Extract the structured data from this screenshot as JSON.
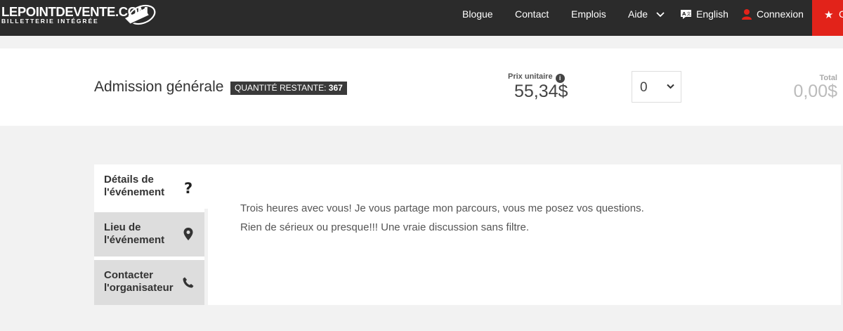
{
  "header": {
    "logo_main": "LEPOINTDEVENTE.COM",
    "logo_sub": "BILLETTERIE INTÉGRÉE",
    "nav": {
      "blogue": "Blogue",
      "contact": "Contact",
      "emplois": "Emplois",
      "aide": "Aide",
      "english": "English",
      "connexion": "Connexion",
      "cart_partial": "C"
    },
    "icons": {
      "aide": "chevron-down-icon",
      "english": "translate-icon",
      "connexion": "user-icon",
      "cart": "star-icon"
    },
    "colors": {
      "bar": "#2b2b2b",
      "accent": "#e2231a"
    }
  },
  "ticket": {
    "name": "Admission générale",
    "remaining_label": "QUANTITÉ RESTANTE:",
    "remaining_value": "367",
    "price_label": "Prix unitaire",
    "price_value": "55,34$",
    "quantity_selected": "0",
    "total_label": "Total",
    "total_value": "0,00$"
  },
  "tabs": [
    {
      "label": "Détails de l'événement",
      "icon": "question-icon",
      "active": true
    },
    {
      "label": "Lieu de l'événement",
      "icon": "map-pin-icon",
      "active": false
    },
    {
      "label": "Contacter l'organisateur",
      "icon": "phone-icon",
      "active": false
    }
  ],
  "tab_icon_glyph": "?",
  "description": {
    "line1": "Trois heures avec vous! Je vous partage mon parcours, vous me posez vos questions.",
    "line2": "Rien de sérieux ou presque!!! Une vraie discussion sans filtre."
  }
}
